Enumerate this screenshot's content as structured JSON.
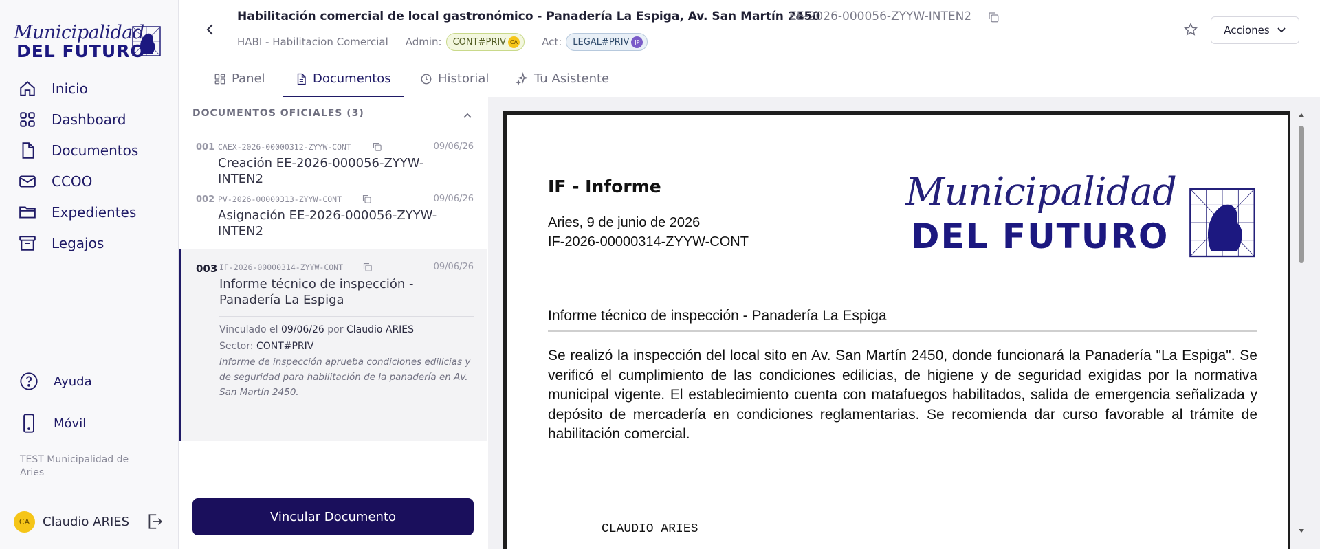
{
  "sidebar": {
    "logo": {
      "script": "Municipalidad",
      "bold": "DEL FUTURO"
    },
    "items": [
      {
        "label": "Inicio",
        "icon": "home-icon"
      },
      {
        "label": "Dashboard",
        "icon": "dashboard-icon"
      },
      {
        "label": "Documentos",
        "icon": "document-icon"
      },
      {
        "label": "CCOO",
        "icon": "mail-icon"
      },
      {
        "label": "Expedientes",
        "icon": "folder-icon"
      },
      {
        "label": "Legajos",
        "icon": "archive-icon"
      }
    ],
    "help_label": "Ayuda",
    "mobile_label": "Móvil",
    "org": "TEST Municipalidad de Aries",
    "user": {
      "initials": "CA",
      "name": "Claudio ARIES"
    }
  },
  "header": {
    "title": "Habilitación comercial de local gastronómico - Panadería La Espiga, Av. San Martín 2450",
    "code": "EE-2026-000056-ZYYW-INTEN2",
    "type": "HABI - Habilitacion Comercial",
    "admin_label": "Admin:",
    "admin_chip": "CONT#PRIV",
    "admin_dot": "CA",
    "act_label": "Act:",
    "act_chip": "LEGAL#PRIV",
    "act_dot": "JP",
    "actions_label": "Acciones"
  },
  "tabs": [
    {
      "label": "Panel"
    },
    {
      "label": "Documentos"
    },
    {
      "label": "Historial"
    },
    {
      "label": "Tu Asistente"
    }
  ],
  "doclist": {
    "heading": "DOCUMENTOS OFICIALES (3)",
    "docs": [
      {
        "num": "001",
        "code": "CAEX-2026-00000312-ZYYW-CONT",
        "date": "09/06/26",
        "title": "Creación EE-2026-000056-ZYYW-INTEN2"
      },
      {
        "num": "002",
        "code": "PV-2026-00000313-ZYYW-CONT",
        "date": "09/06/26",
        "title": "Asignación EE-2026-000056-ZYYW-INTEN2"
      },
      {
        "num": "003",
        "code": "IF-2026-00000314-ZYYW-CONT",
        "date": "09/06/26",
        "title": "Informe técnico de inspección - Panadería La Espiga"
      }
    ],
    "detail": {
      "linked_prefix": "Vinculado el",
      "linked_date": "09/06/26",
      "by": "por",
      "linked_user": "Claudio ARIES",
      "sector_label": "Sector:",
      "sector": "CONT#PRIV",
      "note": "Informe de inspección aprueba condiciones edilicias y de seguridad para habilitación de la panadería en Av. San Martín 2450."
    },
    "link_button": "Vincular Documento"
  },
  "document": {
    "title": "IF - Informe",
    "date": "Aries, 9 de junio de 2026",
    "code": "IF-2026-00000314-ZYYW-CONT",
    "logo": {
      "script": "Municipalidad",
      "bold": "DEL FUTURO"
    },
    "subject": "Informe técnico de inspección - Panadería La Espiga",
    "body": "Se realizó la inspección del local sito en Av. San Martín 2450, donde funcionará la Panadería \"La Espiga\". Se verificó el cumplimiento de las condiciones edilicias, de higiene y de seguridad exigidas por la normativa municipal vigente. El establecimiento cuenta con matafuegos habilitados, salida de emergencia señalizada y depósito de mercadería en condiciones reglamentarias. Se recomienda dar curso favorable al trámite de habilitación comercial.",
    "signature": "CLAUDIO ARIES"
  },
  "colors": {
    "primary": "#1a0f5c",
    "brand": "#1f1a66"
  }
}
